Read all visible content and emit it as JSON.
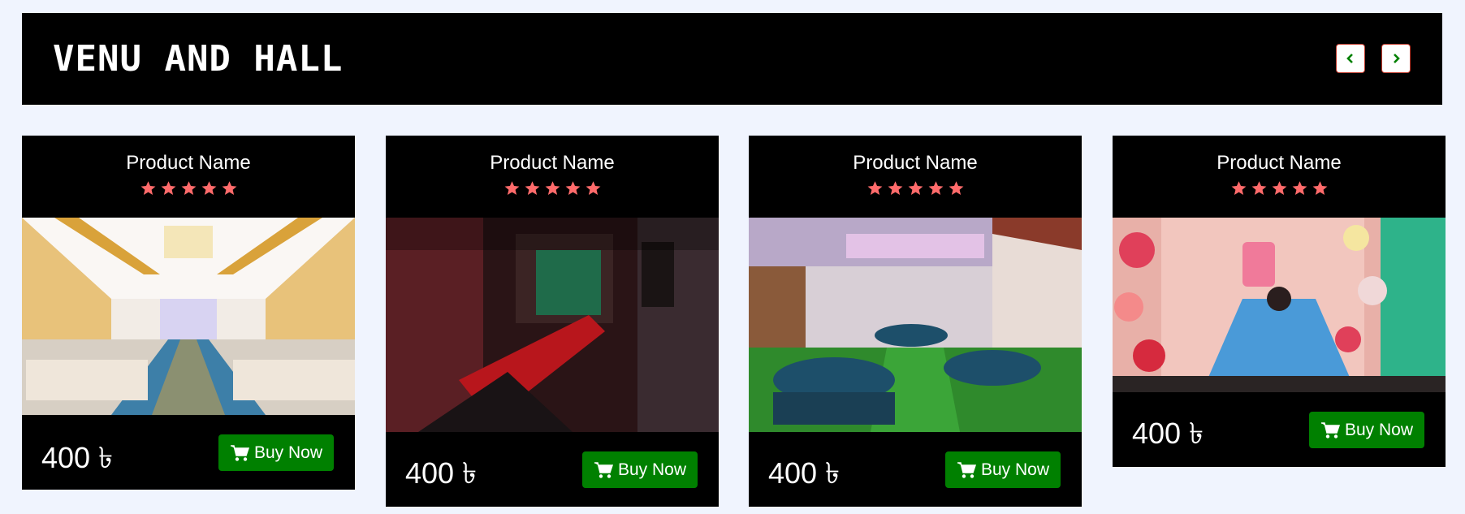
{
  "header": {
    "title": "VENU AND HALL",
    "prev_icon": "chevron-left-icon",
    "next_icon": "chevron-right-icon"
  },
  "colors": {
    "star": "#ff6b6b",
    "buy_button": "#008000",
    "nav_border": "#c0392b",
    "page_bg": "#f0f4fe"
  },
  "products": [
    {
      "name": "Product Name",
      "rating": 5,
      "price": "400 ৳",
      "buy_label": "Buy Now",
      "image": "white-tent-wedding-hall-photo"
    },
    {
      "name": "Product Name",
      "rating": 5,
      "price": "400 ৳",
      "buy_label": "Buy Now",
      "image": "dim-restaurant-dining-room-photo"
    },
    {
      "name": "Product Name",
      "rating": 5,
      "price": "400 ৳",
      "buy_label": "Buy Now",
      "image": "banquet-hall-round-tables-photo"
    },
    {
      "name": "Product Name",
      "rating": 5,
      "price": "400 ৳",
      "buy_label": "Buy Now",
      "image": "birthday-flower-backdrop-photo"
    }
  ]
}
